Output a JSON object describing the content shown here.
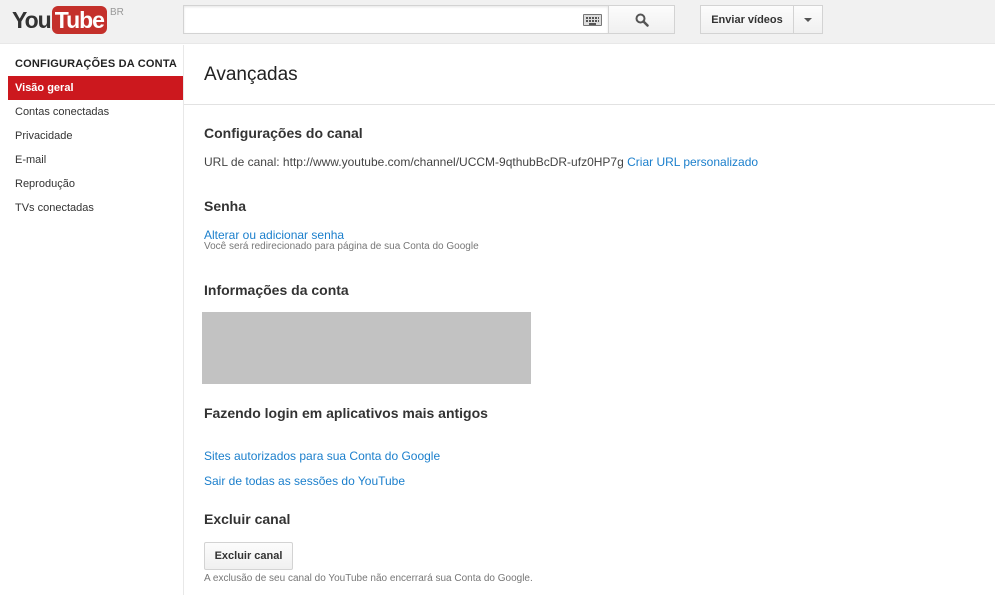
{
  "header": {
    "logo_you": "You",
    "logo_tube": "Tube",
    "logo_region": "BR",
    "search_value": "",
    "search_placeholder": "",
    "upload_label": "Enviar vídeos"
  },
  "sidebar": {
    "title": "CONFIGURAÇÕES DA CONTA",
    "items": [
      {
        "label": "Visão geral",
        "active": true
      },
      {
        "label": "Contas conectadas",
        "active": false
      },
      {
        "label": "Privacidade",
        "active": false
      },
      {
        "label": "E-mail",
        "active": false
      },
      {
        "label": "Reprodução",
        "active": false
      },
      {
        "label": "TVs conectadas",
        "active": false
      }
    ]
  },
  "main": {
    "title": "Avançadas",
    "channel": {
      "title": "Configurações do canal",
      "url_label": "URL de canal: http://www.youtube.com/channel/UCCM-9qthubBcDR-ufz0HP7g",
      "custom_url_link": "Criar URL personalizado"
    },
    "password": {
      "title": "Senha",
      "link": "Alterar ou adicionar senha",
      "hint": "Você será redirecionado para página de sua Conta do Google"
    },
    "account_info": {
      "title": "Informações da conta"
    },
    "legacy_login": {
      "title": "Fazendo login em aplicativos mais antigos",
      "link_sites": "Sites autorizados para sua Conta do Google",
      "link_signout": "Sair de todas as sessões do YouTube"
    },
    "delete": {
      "title": "Excluir canal",
      "button": "Excluir canal",
      "hint": "A exclusão de seu canal do YouTube não encerrará sua Conta do Google."
    }
  },
  "colors": {
    "brand_red": "#cc181e",
    "link_blue": "#1b7fcc"
  }
}
